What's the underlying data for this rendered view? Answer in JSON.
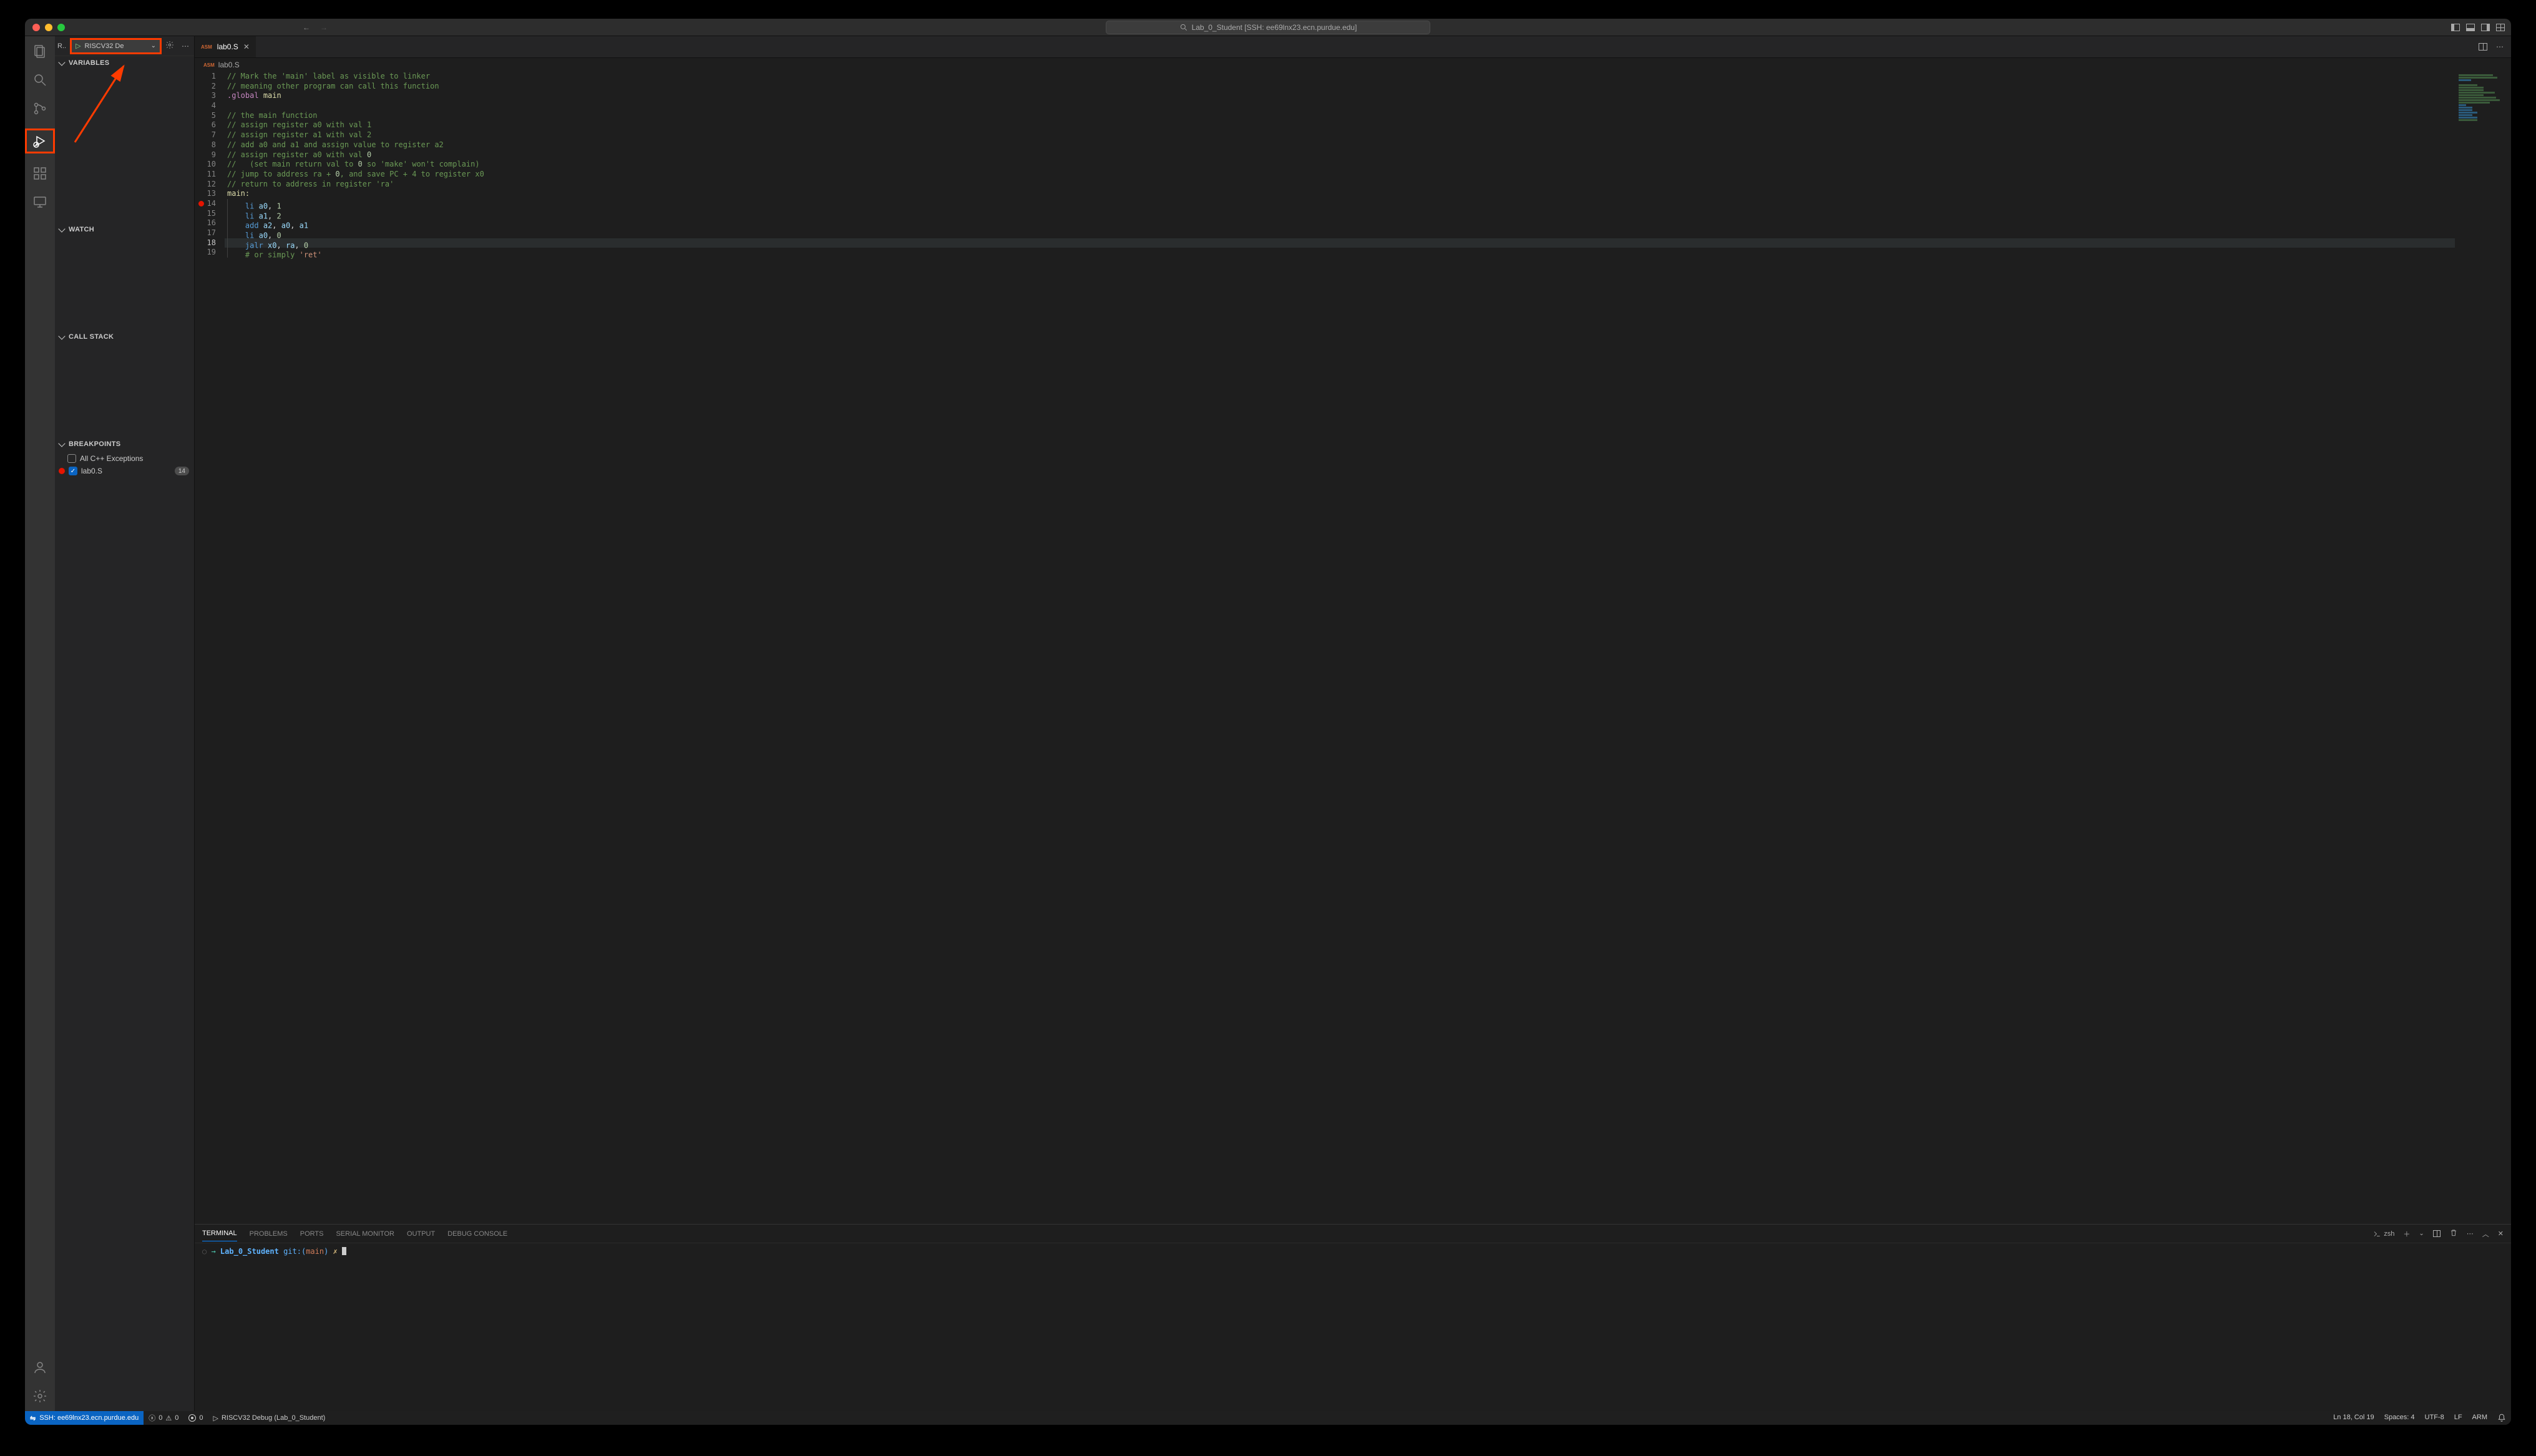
{
  "titlebar": {
    "search_text": "Lab_0_Student [SSH: ee69lnx23.ecn.purdue.edu]"
  },
  "debug_header": {
    "title": "R..",
    "config": "RISCV32 De"
  },
  "sections": {
    "variables": "VARIABLES",
    "watch": "WATCH",
    "callstack": "CALL STACK",
    "breakpoints": "BREAKPOINTS"
  },
  "breakpoints": {
    "all_cpp": "All C++ Exceptions",
    "file": "lab0.S",
    "line_badge": "14"
  },
  "tab": {
    "badge": "ASM",
    "name": "lab0.S"
  },
  "breadcrumb": {
    "badge": "ASM",
    "file": "lab0.S"
  },
  "code": {
    "lines": [
      {
        "n": 1,
        "html": "<span class='c-comment'>// Mark the 'main' label as visible to linker</span>"
      },
      {
        "n": 2,
        "html": "<span class='c-comment'>// meaning other program can call this function</span>"
      },
      {
        "n": 3,
        "html": "<span class='c-dir'>.global</span> <span class='c-label'>main</span>"
      },
      {
        "n": 4,
        "html": ""
      },
      {
        "n": 5,
        "html": "<span class='c-comment'>// the main function</span>"
      },
      {
        "n": 6,
        "html": "<span class='c-comment'>// assign register a0 with val 1</span>"
      },
      {
        "n": 7,
        "html": "<span class='c-comment'>// assign register a1 with val 2</span>"
      },
      {
        "n": 8,
        "html": "<span class='c-comment'>// add a0 and a1 and assign value to register a2</span>"
      },
      {
        "n": 9,
        "html": "<span class='c-comment'>// assign register a0 with val </span><span class='c-num'>0</span>"
      },
      {
        "n": 10,
        "html": "<span class='c-comment'>//   (set main return val to </span><span class='c-num'>0</span><span class='c-comment'> so 'make' won't complain)</span>"
      },
      {
        "n": 11,
        "html": "<span class='c-comment'>// jump to address ra + </span><span class='c-num'>0</span><span class='c-comment'>, and save PC + 4 to register x0</span>"
      },
      {
        "n": 12,
        "html": "<span class='c-comment'>// return to address in register 'ra'</span>"
      },
      {
        "n": 13,
        "html": "<span class='c-label'>main:</span>"
      },
      {
        "n": 14,
        "html": "    <span class='c-op'>li</span> <span class='c-reg'>a0</span><span class='c-punc'>,</span> <span class='c-num'>1</span>",
        "bp": true
      },
      {
        "n": 15,
        "html": "    <span class='c-op'>li</span> <span class='c-reg'>a1</span><span class='c-punc'>,</span> <span class='c-num'>2</span>"
      },
      {
        "n": 16,
        "html": "    <span class='c-op'>add</span> <span class='c-reg'>a2</span><span class='c-punc'>,</span> <span class='c-reg'>a0</span><span class='c-punc'>,</span> <span class='c-reg'>a1</span>"
      },
      {
        "n": 17,
        "html": "    <span class='c-op'>li</span> <span class='c-reg'>a0</span><span class='c-punc'>,</span> <span class='c-num'>0</span>"
      },
      {
        "n": 18,
        "html": "    <span class='c-op'>jalr</span> <span class='c-reg'>x0</span><span class='c-punc'>,</span> <span class='c-reg'>ra</span><span class='c-punc'>,</span> <span class='c-num'>0</span>",
        "cur": true
      },
      {
        "n": 19,
        "html": "    <span class='c-comment'># or simply </span><span class='c-str'>'ret'</span>"
      }
    ]
  },
  "panel": {
    "tabs": [
      "TERMINAL",
      "PROBLEMS",
      "PORTS",
      "SERIAL MONITOR",
      "OUTPUT",
      "DEBUG CONSOLE"
    ],
    "active": 0,
    "shell": "zsh"
  },
  "terminal": {
    "dir": "Lab_0_Student",
    "git_label": "git:(",
    "branch": "main",
    "git_close": ")",
    "flag": "✗"
  },
  "status": {
    "remote": "SSH: ee69lnx23.ecn.purdue.edu",
    "errors": "0",
    "warnings": "0",
    "ports": "0",
    "launch": "RISCV32 Debug (Lab_0_Student)",
    "position": "Ln 18, Col 19",
    "spaces": "Spaces: 4",
    "encoding": "UTF-8",
    "eol": "LF",
    "lang": "ARM"
  }
}
